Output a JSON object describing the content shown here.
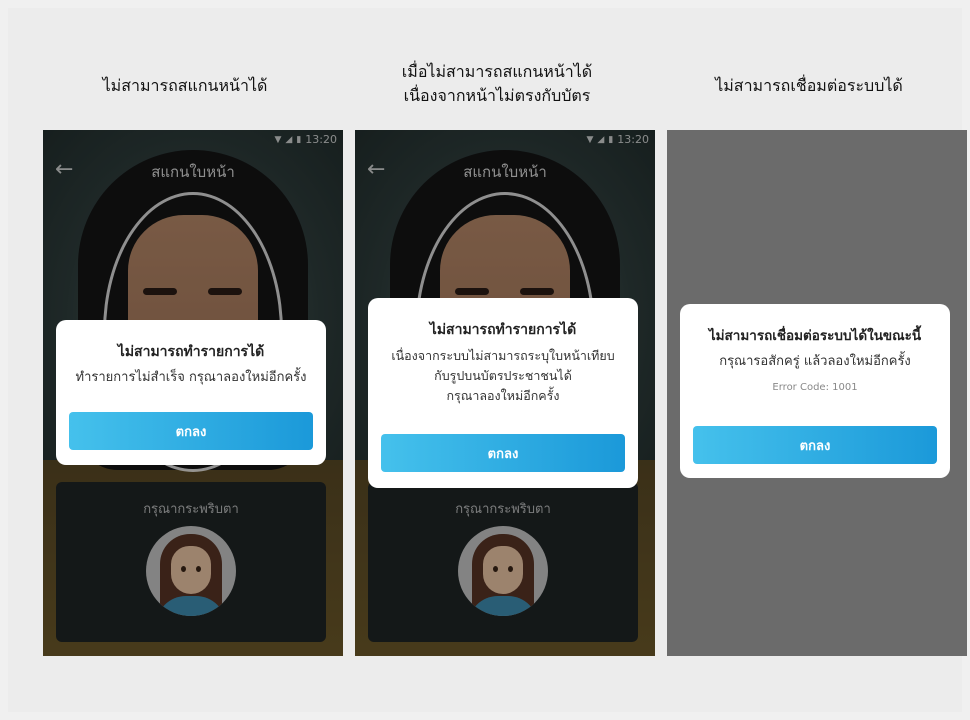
{
  "screens": [
    {
      "caption": "ไม่สามารถสแกนหน้าได้",
      "status_time": "13:20",
      "title": "สแกนใบหน้า",
      "blink_hint": "กรุณากระพริบตา",
      "dialog": {
        "title": "ไม่สามารถทำรายการได้",
        "body": "ทำรายการไม่สำเร็จ กรุณาลองใหม่อีกครั้ง",
        "button": "ตกลง"
      }
    },
    {
      "caption_line1": "เมื่อไม่สามารถสแกนหน้าได้",
      "caption_line2": "เนื่องจากหน้าไม่ตรงกับบัตร",
      "status_time": "13:20",
      "title": "สแกนใบหน้า",
      "blink_hint": "กรุณากระพริบตา",
      "dialog": {
        "title": "ไม่สามารถทำรายการได้",
        "body_line1": "เนื่องจากระบบไม่สามารถระบุใบหน้าเทียบ",
        "body_line2": "กับรูปบนบัตรประชาชนได้",
        "body_line3": "กรุณาลองใหม่อีกครั้ง",
        "button": "ตกลง"
      }
    },
    {
      "caption": "ไม่สามารถเชื่อมต่อระบบได้",
      "dialog": {
        "title": "ไม่สามารถเชื่อมต่อระบบได้ในขณะนี้",
        "body": "กรุณารอสักครู่ แล้วลองใหม่อีกครั้ง",
        "code": "Error Code: 1001",
        "button": "ตกลง"
      }
    }
  ]
}
